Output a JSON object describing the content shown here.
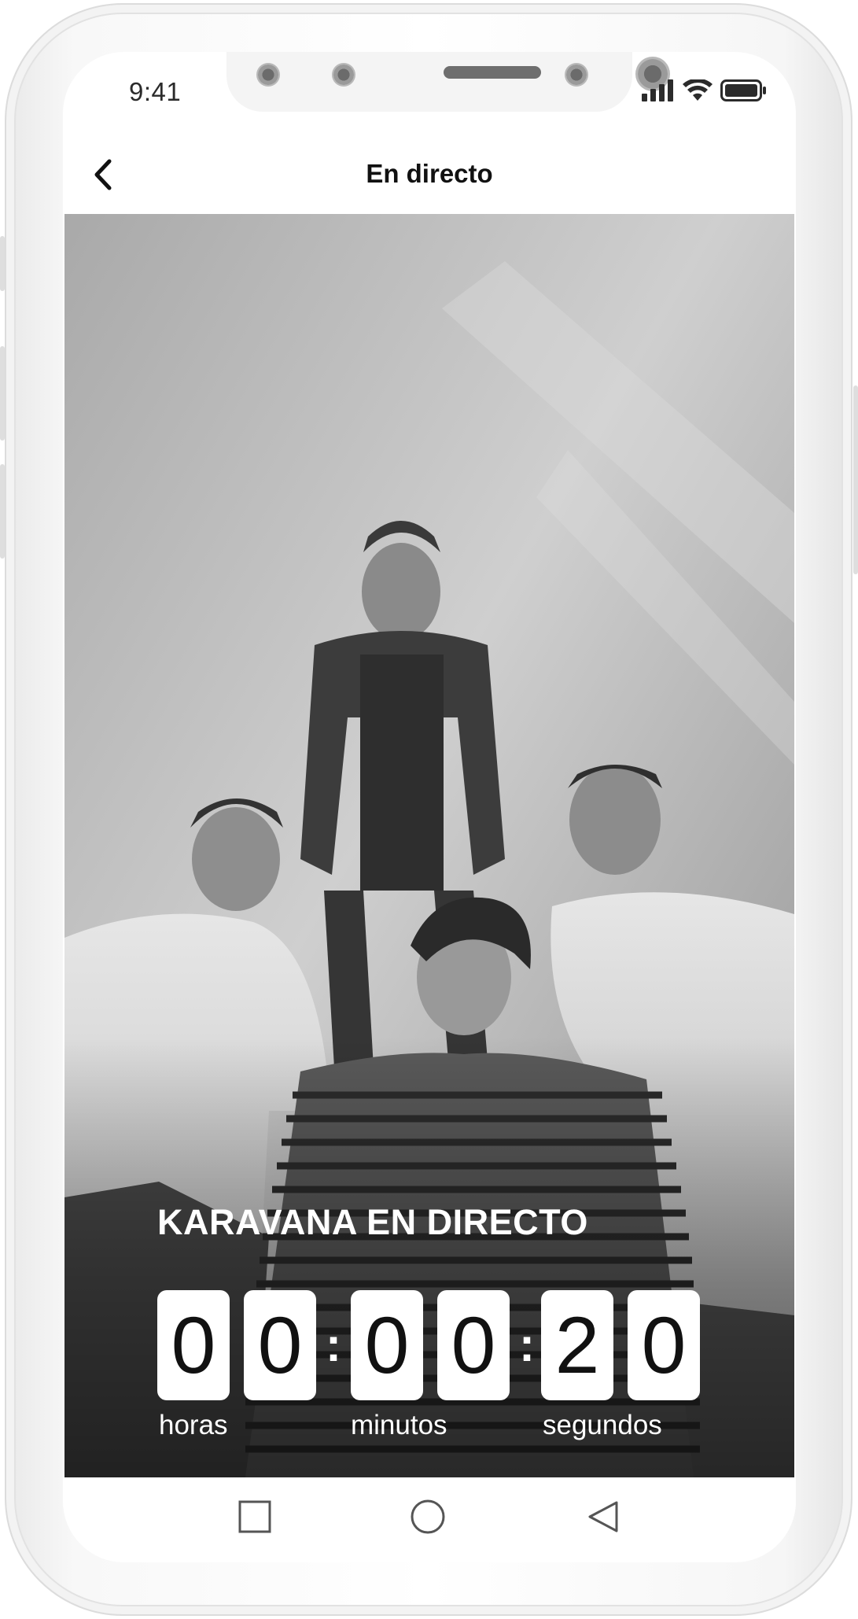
{
  "status_bar": {
    "time": "9:41",
    "icons": [
      "signal-icon",
      "wifi-icon",
      "battery-icon"
    ]
  },
  "header": {
    "back_icon": "chevron-left-icon",
    "title": "En directo"
  },
  "event": {
    "title": "KARAVANA EN DIRECTO"
  },
  "countdown": {
    "digits": [
      "0",
      "0",
      "0",
      "0",
      "2",
      "0"
    ],
    "separator": ":",
    "labels": {
      "hours": "horas",
      "minutes": "minutos",
      "seconds": "segundos"
    }
  },
  "nav_bar": {
    "items": [
      "recent-apps-icon",
      "home-icon",
      "back-triangle-icon"
    ]
  },
  "colors": {
    "countdown_box": "#ffffff",
    "countdown_digit": "#111111",
    "overlay_text": "#ffffff",
    "header_text": "#111111"
  }
}
